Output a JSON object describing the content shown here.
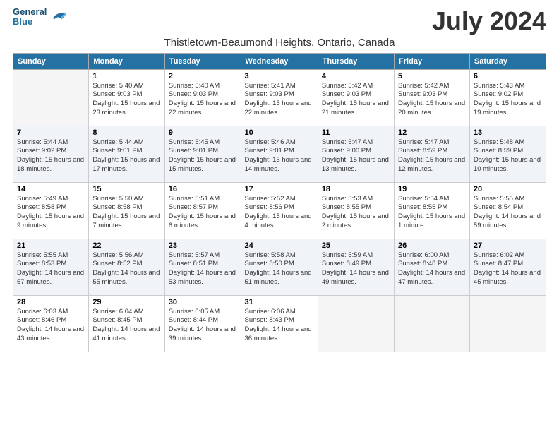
{
  "logo": {
    "line1": "General",
    "line2": "Blue"
  },
  "title": "July 2024",
  "subtitle": "Thistletown-Beaumond Heights, Ontario, Canada",
  "days_of_week": [
    "Sunday",
    "Monday",
    "Tuesday",
    "Wednesday",
    "Thursday",
    "Friday",
    "Saturday"
  ],
  "weeks": [
    [
      {
        "num": "",
        "empty": true
      },
      {
        "num": "1",
        "sunrise": "Sunrise: 5:40 AM",
        "sunset": "Sunset: 9:03 PM",
        "daylight": "Daylight: 15 hours and 23 minutes."
      },
      {
        "num": "2",
        "sunrise": "Sunrise: 5:40 AM",
        "sunset": "Sunset: 9:03 PM",
        "daylight": "Daylight: 15 hours and 22 minutes."
      },
      {
        "num": "3",
        "sunrise": "Sunrise: 5:41 AM",
        "sunset": "Sunset: 9:03 PM",
        "daylight": "Daylight: 15 hours and 22 minutes."
      },
      {
        "num": "4",
        "sunrise": "Sunrise: 5:42 AM",
        "sunset": "Sunset: 9:03 PM",
        "daylight": "Daylight: 15 hours and 21 minutes."
      },
      {
        "num": "5",
        "sunrise": "Sunrise: 5:42 AM",
        "sunset": "Sunset: 9:03 PM",
        "daylight": "Daylight: 15 hours and 20 minutes."
      },
      {
        "num": "6",
        "sunrise": "Sunrise: 5:43 AM",
        "sunset": "Sunset: 9:02 PM",
        "daylight": "Daylight: 15 hours and 19 minutes."
      }
    ],
    [
      {
        "num": "7",
        "sunrise": "Sunrise: 5:44 AM",
        "sunset": "Sunset: 9:02 PM",
        "daylight": "Daylight: 15 hours and 18 minutes."
      },
      {
        "num": "8",
        "sunrise": "Sunrise: 5:44 AM",
        "sunset": "Sunset: 9:01 PM",
        "daylight": "Daylight: 15 hours and 17 minutes."
      },
      {
        "num": "9",
        "sunrise": "Sunrise: 5:45 AM",
        "sunset": "Sunset: 9:01 PM",
        "daylight": "Daylight: 15 hours and 15 minutes."
      },
      {
        "num": "10",
        "sunrise": "Sunrise: 5:46 AM",
        "sunset": "Sunset: 9:01 PM",
        "daylight": "Daylight: 15 hours and 14 minutes."
      },
      {
        "num": "11",
        "sunrise": "Sunrise: 5:47 AM",
        "sunset": "Sunset: 9:00 PM",
        "daylight": "Daylight: 15 hours and 13 minutes."
      },
      {
        "num": "12",
        "sunrise": "Sunrise: 5:47 AM",
        "sunset": "Sunset: 8:59 PM",
        "daylight": "Daylight: 15 hours and 12 minutes."
      },
      {
        "num": "13",
        "sunrise": "Sunrise: 5:48 AM",
        "sunset": "Sunset: 8:59 PM",
        "daylight": "Daylight: 15 hours and 10 minutes."
      }
    ],
    [
      {
        "num": "14",
        "sunrise": "Sunrise: 5:49 AM",
        "sunset": "Sunset: 8:58 PM",
        "daylight": "Daylight: 15 hours and 9 minutes."
      },
      {
        "num": "15",
        "sunrise": "Sunrise: 5:50 AM",
        "sunset": "Sunset: 8:58 PM",
        "daylight": "Daylight: 15 hours and 7 minutes."
      },
      {
        "num": "16",
        "sunrise": "Sunrise: 5:51 AM",
        "sunset": "Sunset: 8:57 PM",
        "daylight": "Daylight: 15 hours and 6 minutes."
      },
      {
        "num": "17",
        "sunrise": "Sunrise: 5:52 AM",
        "sunset": "Sunset: 8:56 PM",
        "daylight": "Daylight: 15 hours and 4 minutes."
      },
      {
        "num": "18",
        "sunrise": "Sunrise: 5:53 AM",
        "sunset": "Sunset: 8:55 PM",
        "daylight": "Daylight: 15 hours and 2 minutes."
      },
      {
        "num": "19",
        "sunrise": "Sunrise: 5:54 AM",
        "sunset": "Sunset: 8:55 PM",
        "daylight": "Daylight: 15 hours and 1 minute."
      },
      {
        "num": "20",
        "sunrise": "Sunrise: 5:55 AM",
        "sunset": "Sunset: 8:54 PM",
        "daylight": "Daylight: 14 hours and 59 minutes."
      }
    ],
    [
      {
        "num": "21",
        "sunrise": "Sunrise: 5:55 AM",
        "sunset": "Sunset: 8:53 PM",
        "daylight": "Daylight: 14 hours and 57 minutes."
      },
      {
        "num": "22",
        "sunrise": "Sunrise: 5:56 AM",
        "sunset": "Sunset: 8:52 PM",
        "daylight": "Daylight: 14 hours and 55 minutes."
      },
      {
        "num": "23",
        "sunrise": "Sunrise: 5:57 AM",
        "sunset": "Sunset: 8:51 PM",
        "daylight": "Daylight: 14 hours and 53 minutes."
      },
      {
        "num": "24",
        "sunrise": "Sunrise: 5:58 AM",
        "sunset": "Sunset: 8:50 PM",
        "daylight": "Daylight: 14 hours and 51 minutes."
      },
      {
        "num": "25",
        "sunrise": "Sunrise: 5:59 AM",
        "sunset": "Sunset: 8:49 PM",
        "daylight": "Daylight: 14 hours and 49 minutes."
      },
      {
        "num": "26",
        "sunrise": "Sunrise: 6:00 AM",
        "sunset": "Sunset: 8:48 PM",
        "daylight": "Daylight: 14 hours and 47 minutes."
      },
      {
        "num": "27",
        "sunrise": "Sunrise: 6:02 AM",
        "sunset": "Sunset: 8:47 PM",
        "daylight": "Daylight: 14 hours and 45 minutes."
      }
    ],
    [
      {
        "num": "28",
        "sunrise": "Sunrise: 6:03 AM",
        "sunset": "Sunset: 8:46 PM",
        "daylight": "Daylight: 14 hours and 43 minutes."
      },
      {
        "num": "29",
        "sunrise": "Sunrise: 6:04 AM",
        "sunset": "Sunset: 8:45 PM",
        "daylight": "Daylight: 14 hours and 41 minutes."
      },
      {
        "num": "30",
        "sunrise": "Sunrise: 6:05 AM",
        "sunset": "Sunset: 8:44 PM",
        "daylight": "Daylight: 14 hours and 39 minutes."
      },
      {
        "num": "31",
        "sunrise": "Sunrise: 6:06 AM",
        "sunset": "Sunset: 8:43 PM",
        "daylight": "Daylight: 14 hours and 36 minutes."
      },
      {
        "num": "",
        "empty": true
      },
      {
        "num": "",
        "empty": true
      },
      {
        "num": "",
        "empty": true
      }
    ]
  ]
}
